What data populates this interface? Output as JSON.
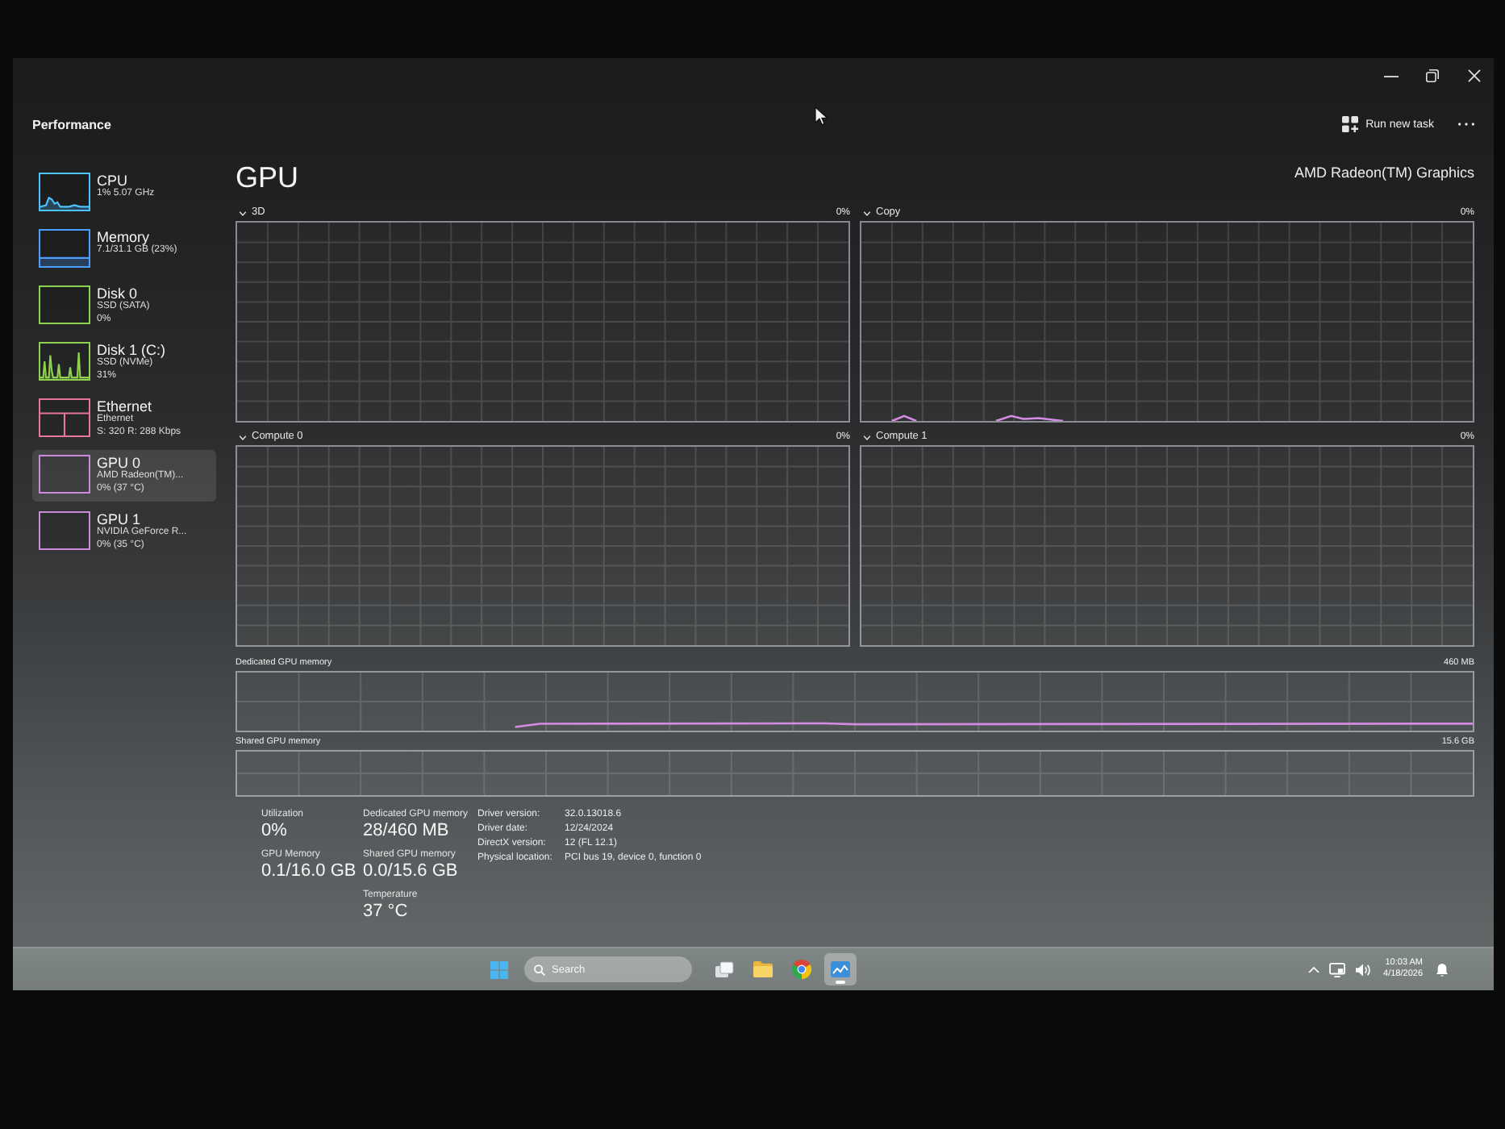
{
  "window": {
    "title": "Performance"
  },
  "toolbar": {
    "run_task": "Run new task"
  },
  "sidebar": {
    "items": [
      {
        "name": "CPU",
        "details": [
          "1% 5.07 GHz"
        ],
        "color": "#4cc2ff",
        "selected": false
      },
      {
        "name": "Memory",
        "details": [
          "7.1/31.1 GB (23%)"
        ],
        "color": "#4c9eff",
        "selected": false
      },
      {
        "name": "Disk 0",
        "details": [
          "SSD (SATA)",
          "0%"
        ],
        "color": "#8fd14f",
        "selected": false
      },
      {
        "name": "Disk 1 (C:)",
        "details": [
          "SSD (NVMe)",
          "31%"
        ],
        "color": "#8fd14f",
        "selected": false
      },
      {
        "name": "Ethernet",
        "details": [
          "Ethernet",
          "S: 320 R: 288 Kbps"
        ],
        "color": "#e8749e",
        "selected": false
      },
      {
        "name": "GPU 0",
        "details": [
          "AMD Radeon(TM)...",
          "0% (37 °C)"
        ],
        "color": "#c98bd8",
        "selected": true
      },
      {
        "name": "GPU 1",
        "details": [
          "NVIDIA GeForce R...",
          "0% (35 °C)"
        ],
        "color": "#c98bd8",
        "selected": false
      }
    ]
  },
  "page": {
    "title": "GPU",
    "device": "AMD Radeon(TM) Graphics"
  },
  "engines": [
    {
      "name": "3D",
      "value": "0%"
    },
    {
      "name": "Copy",
      "value": "0%"
    },
    {
      "name": "Compute 0",
      "value": "0%"
    },
    {
      "name": "Compute 1",
      "value": "0%"
    }
  ],
  "memory_graphs": [
    {
      "name": "Dedicated GPU memory",
      "max": "460 MB"
    },
    {
      "name": "Shared GPU memory",
      "max": "15.6 GB"
    }
  ],
  "stats": [
    [
      {
        "label": "Utilization",
        "value": "0%"
      },
      {
        "label": "GPU Memory",
        "value": "0.1/16.0 GB"
      }
    ],
    [
      {
        "label": "Dedicated GPU memory",
        "value": "28/460 MB"
      },
      {
        "label": "Shared GPU memory",
        "value": "0.0/15.6 GB"
      },
      {
        "label": "Temperature",
        "value": "37 °C"
      }
    ]
  ],
  "details": [
    {
      "label": "Driver version:",
      "value": "32.0.13018.6"
    },
    {
      "label": "Driver date:",
      "value": "12/24/2024"
    },
    {
      "label": "DirectX version:",
      "value": "12 (FL 12.1)"
    },
    {
      "label": "Physical location:",
      "value": "PCI bus 19, device 0, function 0"
    }
  ],
  "taskbar": {
    "search": {
      "placeholder": "Search"
    },
    "apps": [
      {
        "kind": "taskview",
        "active": false
      },
      {
        "kind": "explorer",
        "active": false
      },
      {
        "kind": "browser",
        "active": false
      },
      {
        "kind": "taskmanager",
        "active": true
      }
    ],
    "time": "10:03 AM",
    "date": "4/18/2026"
  }
}
